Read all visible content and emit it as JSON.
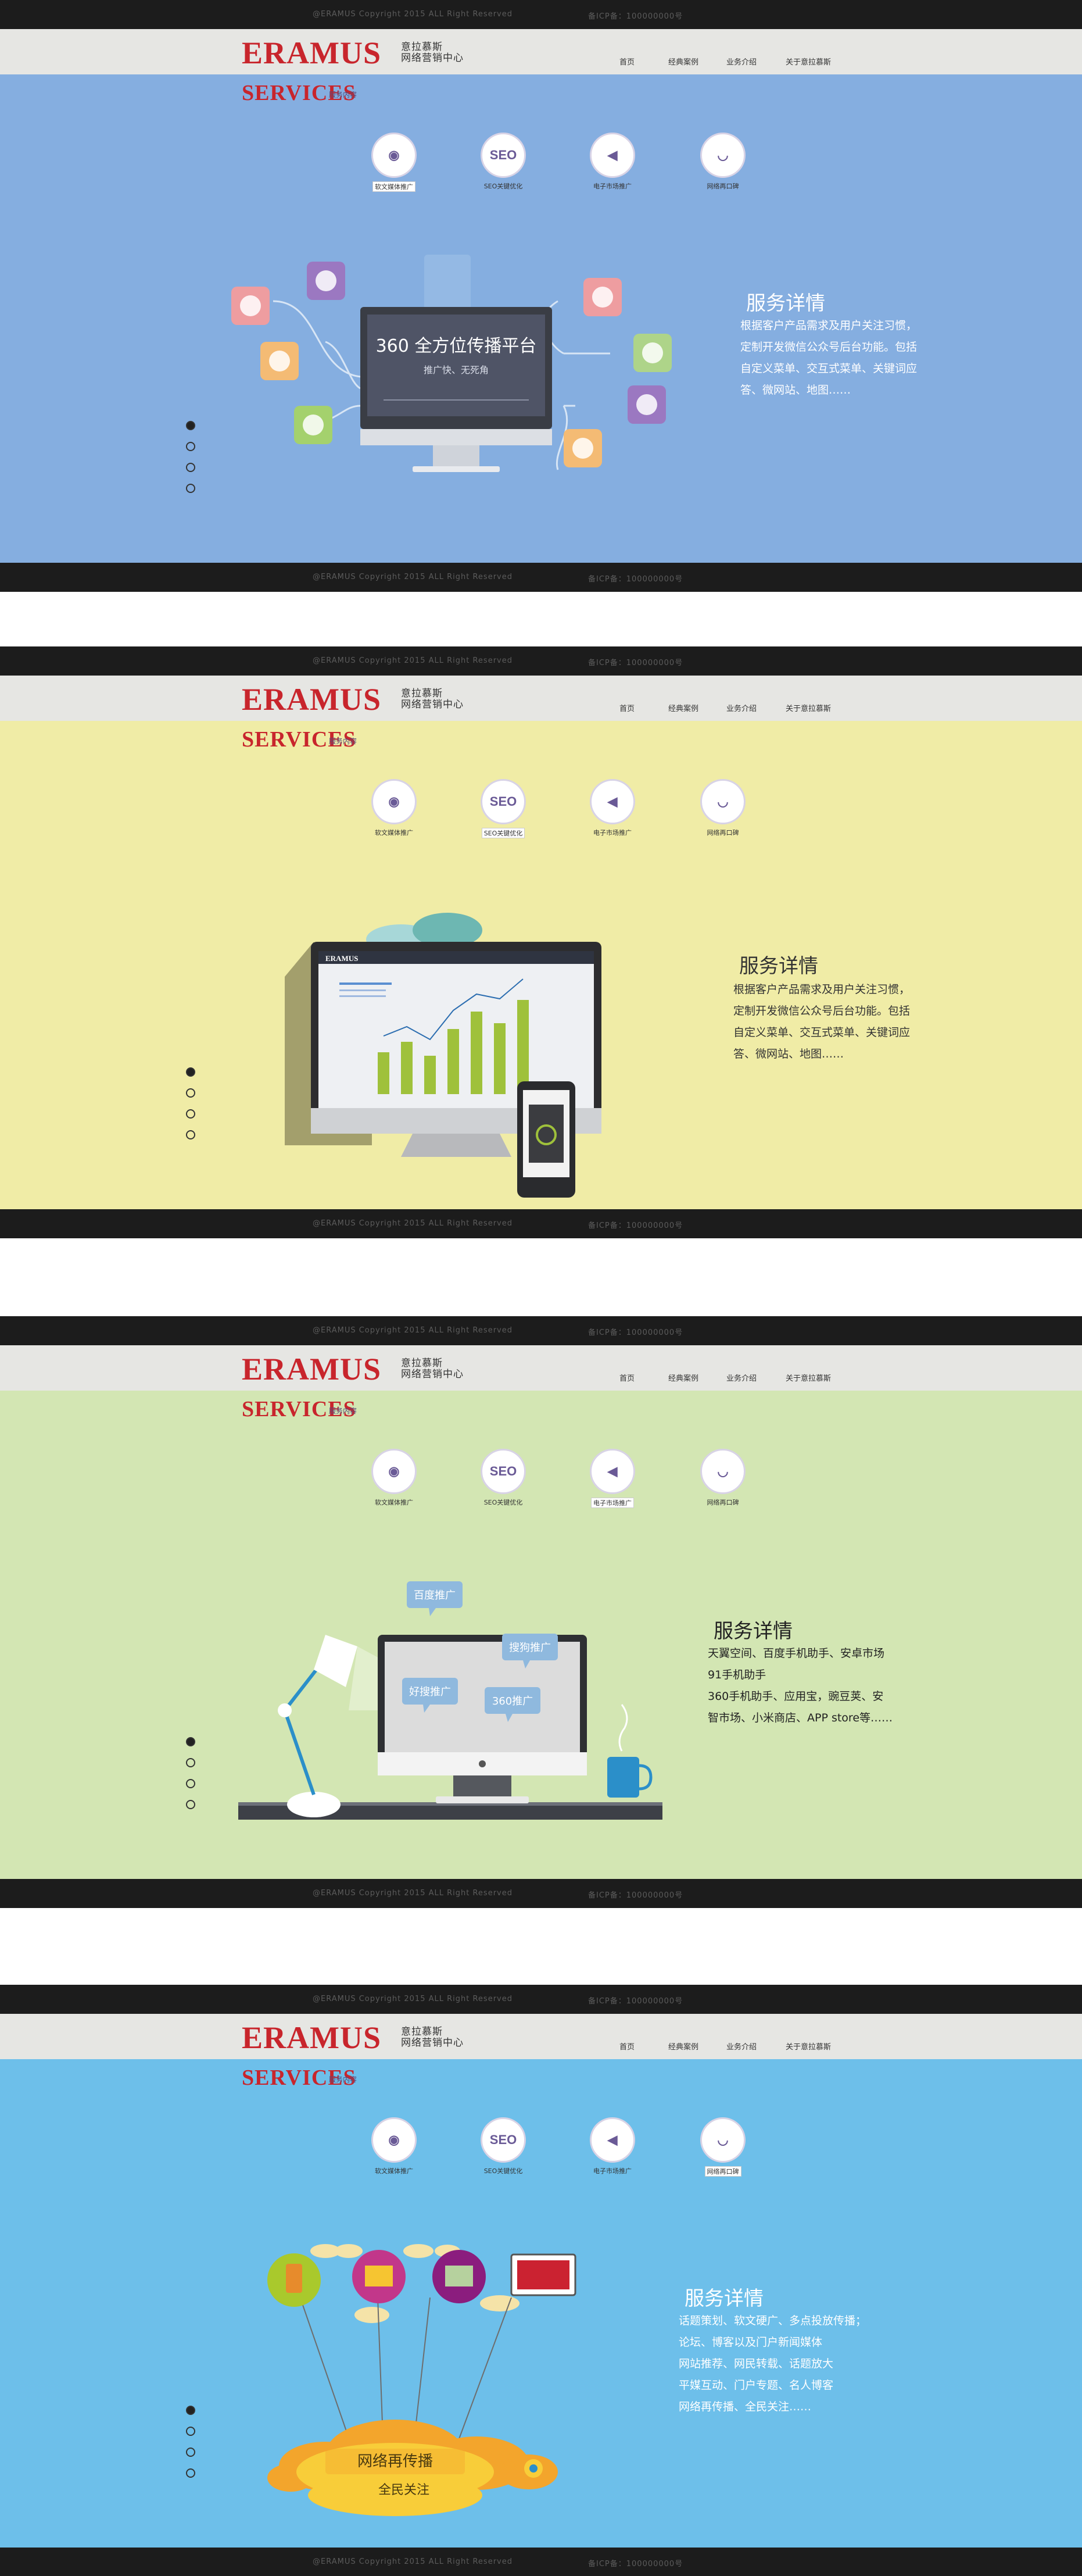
{
  "footer": {
    "copyright": "@ERAMUS Copyright 2015 ALL Right Reserved",
    "icp": "备ICP备：100000000号"
  },
  "brand": {
    "logo": "ERAMUS",
    "cn_line1": "意拉慕斯",
    "cn_line2": "网络营销中心"
  },
  "nav": [
    "首页",
    "经典案例",
    "业务介绍",
    "关于意拉慕斯"
  ],
  "services_heading": "SERVICES",
  "services_sub": "服务内容",
  "service_items": [
    {
      "icon": "megaphone-bubble-icon",
      "glyph": "◉",
      "label": "软文媒体推广"
    },
    {
      "icon": "seo-icon",
      "glyph": "SEO",
      "label": "SEO关键优化"
    },
    {
      "icon": "megaphone-icon",
      "glyph": "◀",
      "label": "电子市场推广"
    },
    {
      "icon": "lips-icon",
      "glyph": "◡",
      "label": "网络再口碑"
    }
  ],
  "slides": [
    {
      "bg": "#85aee0",
      "active_service": 0,
      "detail_title": "服务详情",
      "detail_text": "根据客户产品需求及用户关注习惯，\n定制开发微信公众号后台功能。包括\n自定义菜单、交互式菜单、关键词应\n答、微网站、地图……",
      "screen_title": "360 全方位传播平台",
      "screen_sub": "推广快、无死角"
    },
    {
      "bg": "#f0eca6",
      "active_service": 1,
      "detail_title": "服务详情",
      "detail_text": "根据客户产品需求及用户关注习惯，\n定制开发微信公众号后台功能。包括\n自定义菜单、交互式菜单、关键词应\n答、微网站、地图……",
      "screen_brand": "ERAMUS"
    },
    {
      "bg": "#d3e6b3",
      "active_service": 2,
      "detail_title": "服务详情",
      "detail_text": "天翼空间、百度手机助手、安卓市场\n91手机助手\n360手机助手、应用宝，豌豆荚、安\n智市场、小米商店、APP store等……",
      "bubbles": [
        "百度推广",
        "搜狗推广",
        "好搜推广",
        "360推广"
      ]
    },
    {
      "bg": "#6dbfea",
      "active_service": 3,
      "detail_title": "服务详情",
      "detail_text": "话题策划、软文硬广、多点投放传播；\n论坛、博客以及门户新闻媒体\n网站推荐、网民转载、话题放大\n平媒互动、门户专题、名人博客\n网络再传播、全民关注……",
      "cloud_title": "网络再传播",
      "cloud_sub": "全民关注"
    }
  ]
}
